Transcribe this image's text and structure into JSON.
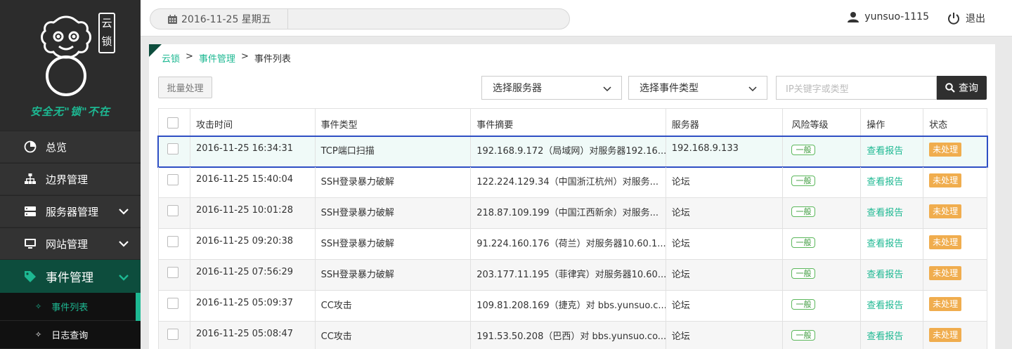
{
  "sidebar": {
    "logo_badge": "云锁",
    "slogan": "安全无\"锁\"不在",
    "items": [
      {
        "label": "总览",
        "icon": "pie-chart-icon"
      },
      {
        "label": "边界管理",
        "icon": "sitemap-icon"
      },
      {
        "label": "服务器管理",
        "icon": "server-icon"
      },
      {
        "label": "网站管理",
        "icon": "monitor-icon"
      },
      {
        "label": "事件管理",
        "icon": "tag-icon"
      }
    ],
    "sub_items": [
      {
        "label": "事件列表"
      },
      {
        "label": "日志查询"
      }
    ]
  },
  "header": {
    "date": "2016-11-25 星期五",
    "username": "yunsuo-1115",
    "logout": "退出"
  },
  "breadcrumb": {
    "root": "云锁",
    "section": "事件管理",
    "page": "事件列表"
  },
  "toolbar": {
    "batch": "批量处理",
    "server_select": "选择服务器",
    "type_select": "选择事件类型",
    "search_placeholder": "IP关键字或类型",
    "search_btn": "查询"
  },
  "table": {
    "headers": [
      "攻击时间",
      "事件类型",
      "事件摘要",
      "服务器",
      "风险等级",
      "操作",
      "状态"
    ],
    "rows": [
      {
        "time": "2016-11-25 16:34:31",
        "type": "TCP端口扫描",
        "summary": "192.168.9.172（局域网）对服务器192.16...",
        "server": "192.168.9.133",
        "risk": "一般",
        "action": "查看报告",
        "status": "未处理"
      },
      {
        "time": "2016-11-25 15:40:04",
        "type": "SSH登录暴力破解",
        "summary": "122.224.129.34（中国浙江杭州）对服务...",
        "server": "论坛",
        "risk": "一般",
        "action": "查看报告",
        "status": "未处理"
      },
      {
        "time": "2016-11-25 10:01:28",
        "type": "SSH登录暴力破解",
        "summary": "218.87.109.199（中国江西新余）对服务...",
        "server": "论坛",
        "risk": "一般",
        "action": "查看报告",
        "status": "未处理"
      },
      {
        "time": "2016-11-25 09:20:38",
        "type": "SSH登录暴力破解",
        "summary": "91.224.160.176（荷兰）对服务器10.60.1...",
        "server": "论坛",
        "risk": "一般",
        "action": "查看报告",
        "status": "未处理"
      },
      {
        "time": "2016-11-25 07:56:29",
        "type": "SSH登录暴力破解",
        "summary": "203.177.11.195（菲律宾）对服务器10.60....",
        "server": "论坛",
        "risk": "一般",
        "action": "查看报告",
        "status": "未处理"
      },
      {
        "time": "2016-11-25 05:09:37",
        "type": "CC攻击",
        "summary": "109.81.208.169（捷克）对 bbs.yunsuo.c...",
        "server": "论坛",
        "risk": "一般",
        "action": "查看报告",
        "status": "未处理"
      },
      {
        "time": "2016-11-25 05:08:47",
        "type": "CC攻击",
        "summary": "191.53.50.208（巴西）对 bbs.yunsuo.co...",
        "server": "论坛",
        "risk": "一般",
        "action": "查看报告",
        "status": "未处理"
      }
    ]
  },
  "colors": {
    "accent": "#1db892",
    "sidebar_bg": "#333333",
    "active_bg": "#0d4d3d",
    "status_orange": "#f0ad4e",
    "highlight_border": "#2e4ec4"
  }
}
